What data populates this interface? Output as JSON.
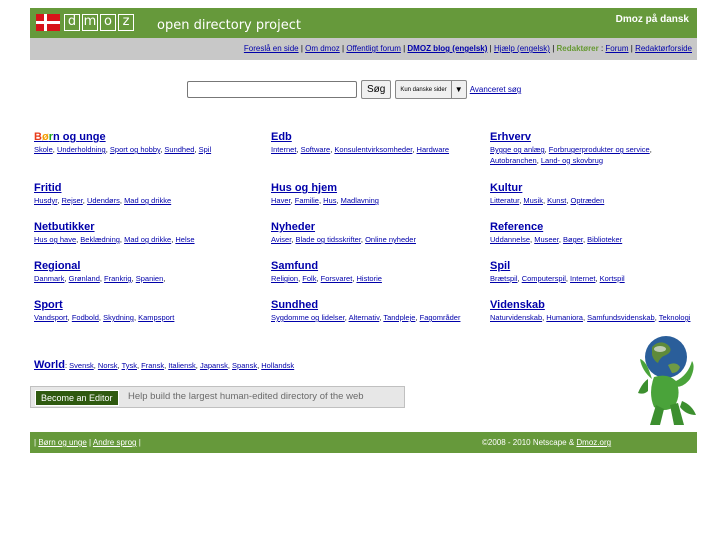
{
  "header": {
    "logo_letters": [
      "d",
      "m",
      "o",
      "z"
    ],
    "tagline": "open directory project",
    "lang_label": "Dmoz på dansk"
  },
  "toplinks": {
    "items": [
      "Foreslå en side",
      "Om dmoz",
      "Offentligt forum",
      "DMOZ blog (engelsk)",
      "Hjælp (engelsk)"
    ],
    "editors_label": "Redaktører",
    "editor_items": [
      "Forum",
      "Redaktørforside"
    ]
  },
  "search": {
    "input_value": "",
    "button_label": "Søg",
    "select_value": "Kun danske sider",
    "advanced_label": "Avanceret søg"
  },
  "categories": [
    {
      "title": "Børn og unge",
      "subs": [
        "Skole",
        "Underholdning",
        "Sport og hobby",
        "Sundhed",
        "Spil"
      ]
    },
    {
      "title": "Edb",
      "subs": [
        "Internet",
        "Software",
        "Konsulentvirksomheder",
        "Hardware"
      ]
    },
    {
      "title": "Erhverv",
      "subs": [
        "Bygge og anlæg",
        "Forbrugerprodukter og service",
        "Autobranchen",
        "Land- og skovbrug"
      ]
    },
    {
      "title": "Fritid",
      "subs": [
        "Husdyr",
        "Rejser",
        "Udendørs",
        "Mad og drikke"
      ]
    },
    {
      "title": "Hus og hjem",
      "subs": [
        "Haver",
        "Familie",
        "Hus",
        "Madlavning"
      ]
    },
    {
      "title": "Kultur",
      "subs": [
        "Litteratur",
        "Musik",
        "Kunst",
        "Optræden"
      ]
    },
    {
      "title": "Netbutikker",
      "subs": [
        "Hus og have",
        "Beklædning",
        "Mad og drikke",
        "Helse"
      ]
    },
    {
      "title": "Nyheder",
      "subs": [
        "Aviser",
        "Blade og tidsskrifter",
        "Online nyheder"
      ]
    },
    {
      "title": "Reference",
      "subs": [
        "Uddannelse",
        "Museer",
        "Bøger",
        "Biblioteker"
      ]
    },
    {
      "title": "Regional",
      "subs": [
        "Danmark",
        "Grønland",
        "Frankrig",
        "Spanien"
      ],
      "trailing": ","
    },
    {
      "title": "Samfund",
      "subs": [
        "Religion",
        "Folk",
        "Forsvaret",
        "Historie"
      ]
    },
    {
      "title": "Spil",
      "subs": [
        "Brætspil",
        "Computerspil",
        "Internet",
        "Kortspil"
      ]
    },
    {
      "title": "Sport",
      "subs": [
        "Vandsport",
        "Fodbold",
        "Skydning",
        "Kampsport"
      ]
    },
    {
      "title": "Sundhed",
      "subs": [
        "Sygdomme og lidelser",
        "Alternativ",
        "Tandpleje",
        "Fagområder"
      ]
    },
    {
      "title": "Videnskab",
      "subs": [
        "Naturvidenskab",
        "Humaniora",
        "Samfundsvidenskab",
        "Teknologi"
      ]
    }
  ],
  "world": {
    "title": "World",
    "subs": [
      "Svensk",
      "Norsk",
      "Tysk",
      "Fransk",
      "Italiensk",
      "Japansk",
      "Spansk",
      "Hollandsk"
    ]
  },
  "editor": {
    "button_label": "Become an Editor",
    "message": "Help build the largest human-edited directory of the web"
  },
  "footer": {
    "links": [
      "Børn og unge",
      "Andre sprog"
    ],
    "copyright_prefix": "©2008 - 2010 Netscape & ",
    "copyright_link": "Dmoz.org"
  },
  "colors": {
    "header_green": "#66993b",
    "link_blue": "#0000aa",
    "toplinks_bg": "#c8c8c8"
  },
  "icons": [
    "danish-flag-icon",
    "earth-dinosaur-mascot-icon",
    "dropdown-arrow-icon"
  ]
}
